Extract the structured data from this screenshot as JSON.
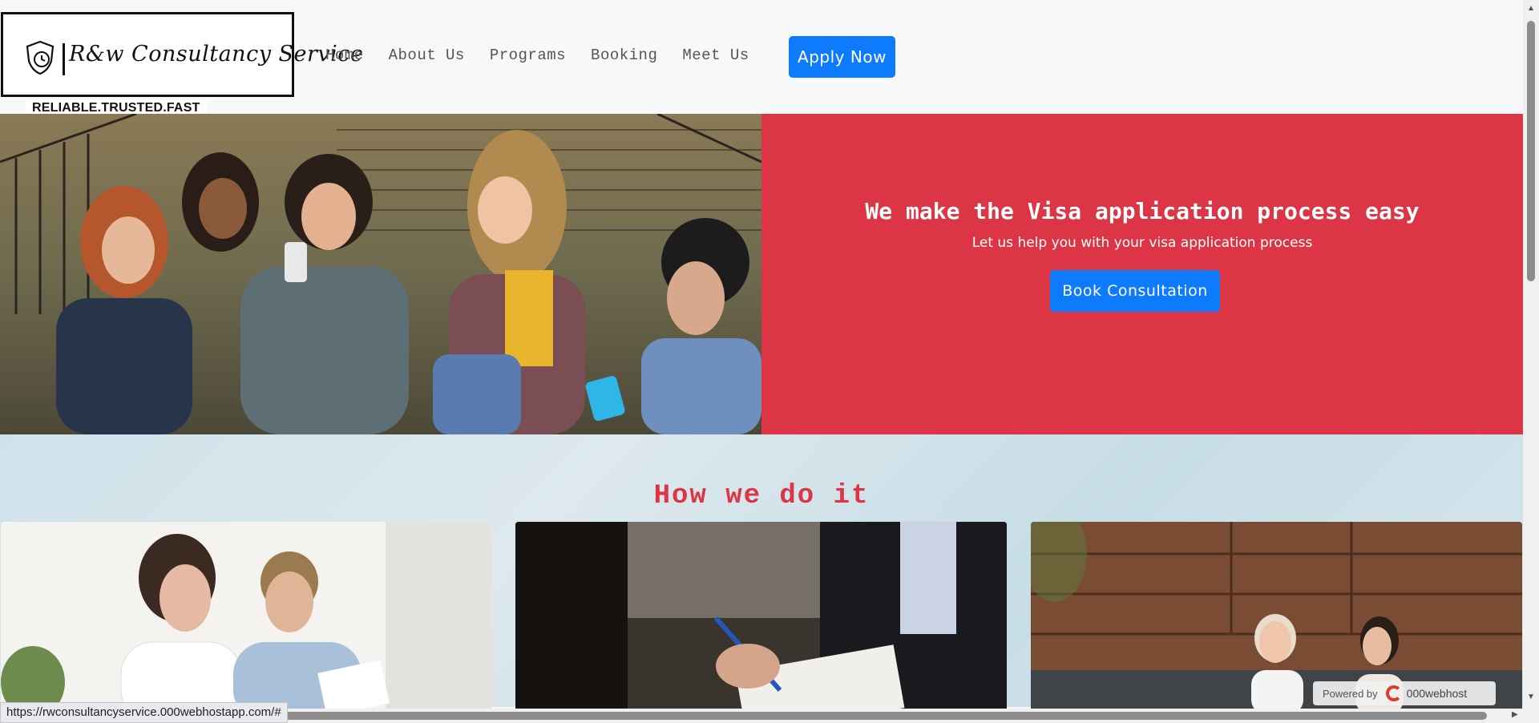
{
  "header": {
    "brand_name": "R&w Consultancy Service",
    "tagline": "RELIABLE.TRUSTED.FAST",
    "nav": [
      {
        "label": "Home"
      },
      {
        "label": "About Us"
      },
      {
        "label": "Programs"
      },
      {
        "label": "Booking"
      },
      {
        "label": "Meet Us"
      }
    ],
    "apply_label": "Apply Now"
  },
  "hero": {
    "title": "We make the Visa application process easy",
    "subtitle": "Let us help you with your visa application process",
    "cta_label": "Book Consultation",
    "image": "group-of-friends-with-phones-photo",
    "bg_color": "#dc3545"
  },
  "how": {
    "title": "How we do it",
    "cards": [
      {
        "image": "consultant-reviewing-documents-photo"
      },
      {
        "image": "signing-paperwork-photo"
      },
      {
        "image": "two-women-meeting-photo"
      }
    ]
  },
  "host_badge": {
    "powered_label": "Powered by",
    "brand": "000webhost"
  },
  "status_bar": {
    "url": "https://rwconsultancyservice.000webhostapp.com/#"
  },
  "colors": {
    "accent_blue": "#0d7bfc",
    "accent_red": "#dc3545"
  }
}
